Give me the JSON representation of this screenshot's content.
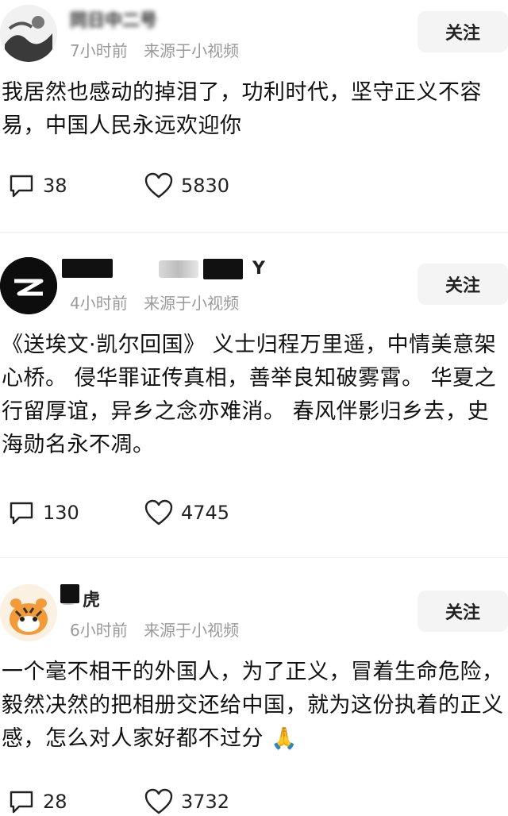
{
  "posts": [
    {
      "name": "同日中二号",
      "time": "7小时前",
      "source": "来源于小视频",
      "follow_label": "关注",
      "content": "我居然也感动的掉泪了，功利时代，坚守正义不容易，中国人民永远欢迎你",
      "comments": "38",
      "likes": "5830"
    },
    {
      "name": "Y",
      "time": "4小时前",
      "source": "来源于小视频",
      "follow_label": "关注",
      "content": "《送埃文·凯尔回国》 义士归程万里遥，中情美意架心桥。 侵华罪证传真相，善举良知破雾霄。 华夏之行留厚谊，异乡之念亦难消。 春风伴影归乡去，史海勋名永不凋。",
      "comments": "130",
      "likes": "4745"
    },
    {
      "name": "虎",
      "time": "6小时前",
      "source": "来源于小视频",
      "follow_label": "关注",
      "content": "一个毫不相干的外国人，为了正义，冒着生命危险，毅然决然的把相册交还给中国，就为这份执着的正义感，怎么对人家好都不过分 🙏",
      "comments": "28",
      "likes": "3732"
    }
  ]
}
